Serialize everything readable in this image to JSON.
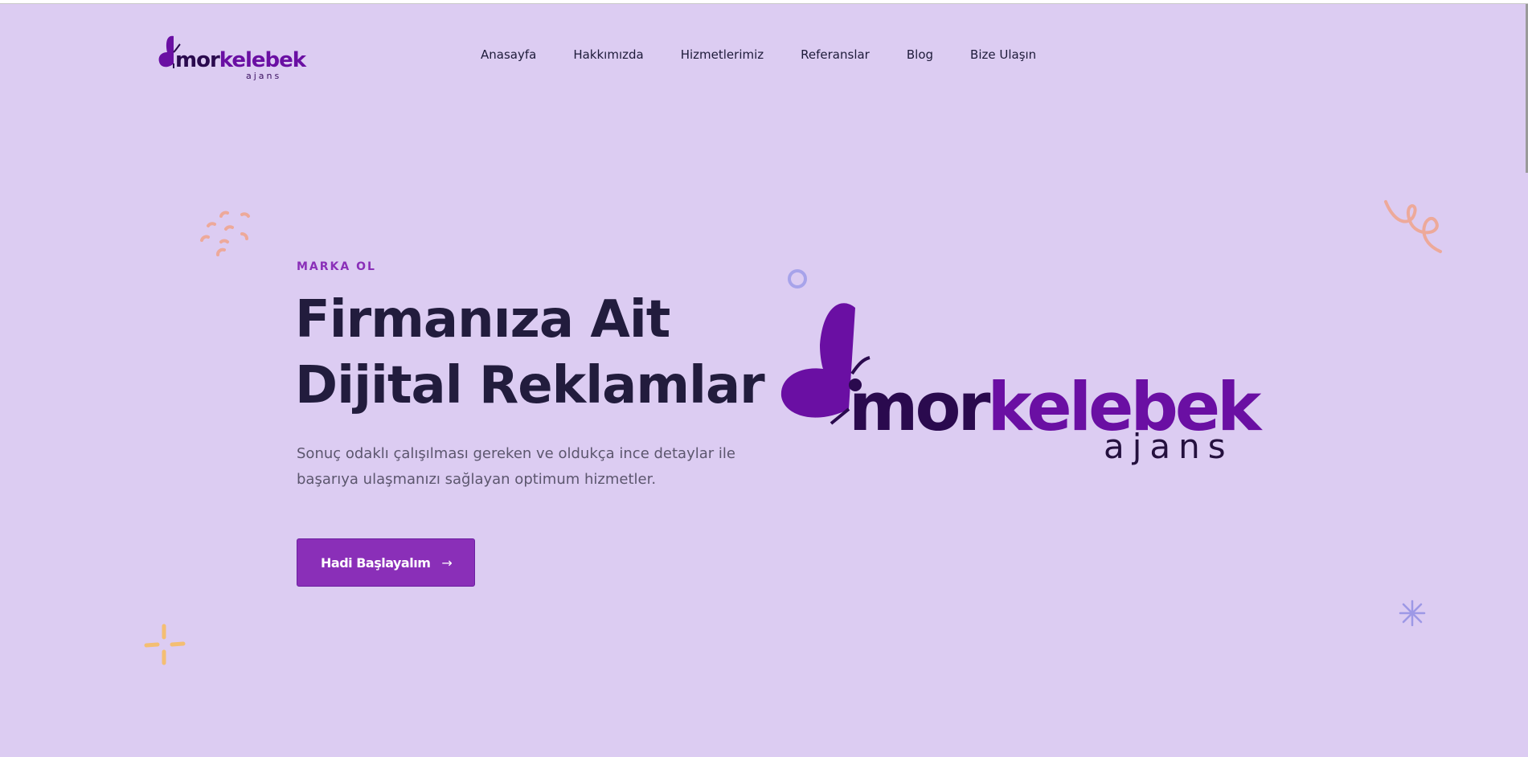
{
  "colors": {
    "background": "#dcccf2",
    "accent": "#8a2fb8",
    "heading": "#221c3d",
    "body_text": "#5c566e",
    "logo_dark": "#2a0a4e",
    "logo_purple": "#6a0fa3"
  },
  "header": {
    "logo": {
      "part_dark": "mor",
      "part_light": "kelebek",
      "sub": "ajans"
    },
    "nav": [
      {
        "label": "Anasayfa"
      },
      {
        "label": "Hakkımızda"
      },
      {
        "label": "Hizmetlerimiz"
      },
      {
        "label": "Referanslar"
      },
      {
        "label": "Blog"
      },
      {
        "label": "Bize Ulaşın"
      }
    ]
  },
  "hero": {
    "eyebrow": "MARKA OL",
    "headline_line1": "Firmanıza Ait",
    "headline_line2": "Dijital Reklamlar",
    "description_line1": "Sonuç odaklı çalışılması gereken ve oldukça ince detaylar ile",
    "description_line2": "başarıya ulaşmanızı sağlayan optimum hizmetler.",
    "cta_label": "Hadi Başlayalım",
    "cta_icon": "arrow-right-icon"
  },
  "hero_logo": {
    "part_dark": "mor",
    "part_light": "kelebek",
    "sub": "ajans",
    "icon": "butterfly-icon"
  },
  "decorations": [
    "dots-cluster-icon",
    "squiggle-icon",
    "circle-icon",
    "sparkle-icon",
    "asterisk-icon"
  ]
}
